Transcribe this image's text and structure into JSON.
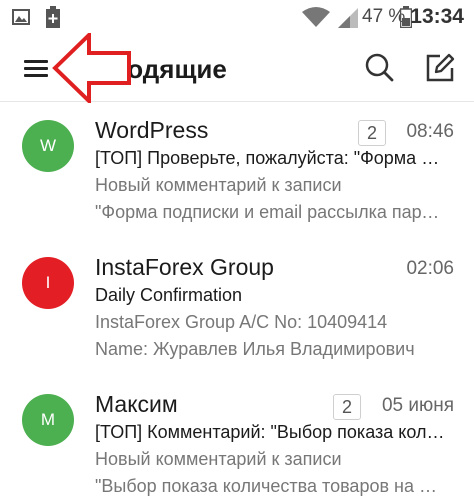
{
  "status_bar": {
    "battery_percent": "47 %",
    "time": "13:34",
    "icons": [
      "image-icon",
      "battery-saver-icon",
      "wifi-icon",
      "signal-icon",
      "battery-icon"
    ]
  },
  "header": {
    "title": "Входящие",
    "menu_icon": "menu-icon",
    "search_icon": "search-icon",
    "compose_icon": "compose-icon"
  },
  "annotation": {
    "arrow_color": "#e02020",
    "arrow_icon": "pointer-arrow-icon"
  },
  "emails": [
    {
      "avatar_letter": "W",
      "avatar_color": "#4caf50",
      "sender": "WordPress",
      "count": "2",
      "time": "08:46",
      "subject": "[ТОП] Проверьте, пожалуйста: \"Форма подписки и email рассылка",
      "snippet1": "Новый комментарий к записи",
      "snippet2": "\"Форма подписки и email рассылка партнерская\""
    },
    {
      "avatar_letter": "I",
      "avatar_color": "#e31e24",
      "sender": "InstaForex Group",
      "count": "",
      "time": "02:06",
      "subject": "Daily Confirmation",
      "snippet1": "InstaForex Group A/C No: 10409414",
      "snippet2": "Name: Журавлев Илья Владимирович"
    },
    {
      "avatar_letter": "M",
      "avatar_color": "#4caf50",
      "sender": "Максим",
      "count": "2",
      "time": "05 июня",
      "subject": "[ТОП] Комментарий: \"Выбор показа количества товаров",
      "snippet1": "Новый комментарий к записи",
      "snippet2": "\"Выбор показа количества товаров на странице\""
    }
  ]
}
